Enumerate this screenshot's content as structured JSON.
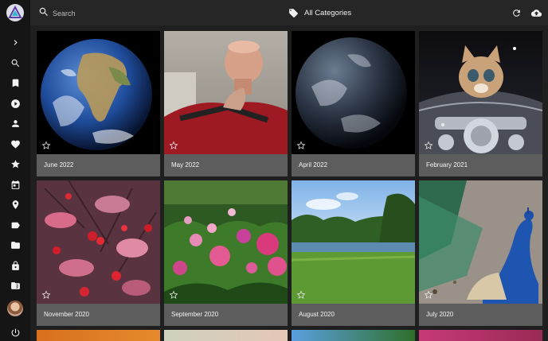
{
  "search": {
    "placeholder": "Search"
  },
  "toolbar": {
    "category_label": "All Categories"
  },
  "sidebar": {
    "items": [
      {
        "icon": "chevron-right-icon"
      },
      {
        "icon": "search-icon"
      },
      {
        "icon": "bookmark-icon"
      },
      {
        "icon": "play-icon"
      },
      {
        "icon": "person-icon"
      },
      {
        "icon": "heart-icon"
      },
      {
        "icon": "star-icon"
      },
      {
        "icon": "calendar-icon"
      },
      {
        "icon": "location-icon"
      },
      {
        "icon": "label-icon"
      },
      {
        "icon": "folder-icon"
      },
      {
        "icon": "lock-icon"
      },
      {
        "icon": "archive-folder-icon"
      },
      {
        "icon": "avatar"
      },
      {
        "icon": "power-icon"
      }
    ]
  },
  "albums": [
    {
      "label": "June 2022"
    },
    {
      "label": "May 2022"
    },
    {
      "label": "April 2022"
    },
    {
      "label": "February 2021"
    },
    {
      "label": "November 2020"
    },
    {
      "label": "September 2020"
    },
    {
      "label": "August 2020"
    },
    {
      "label": "July 2020"
    }
  ]
}
